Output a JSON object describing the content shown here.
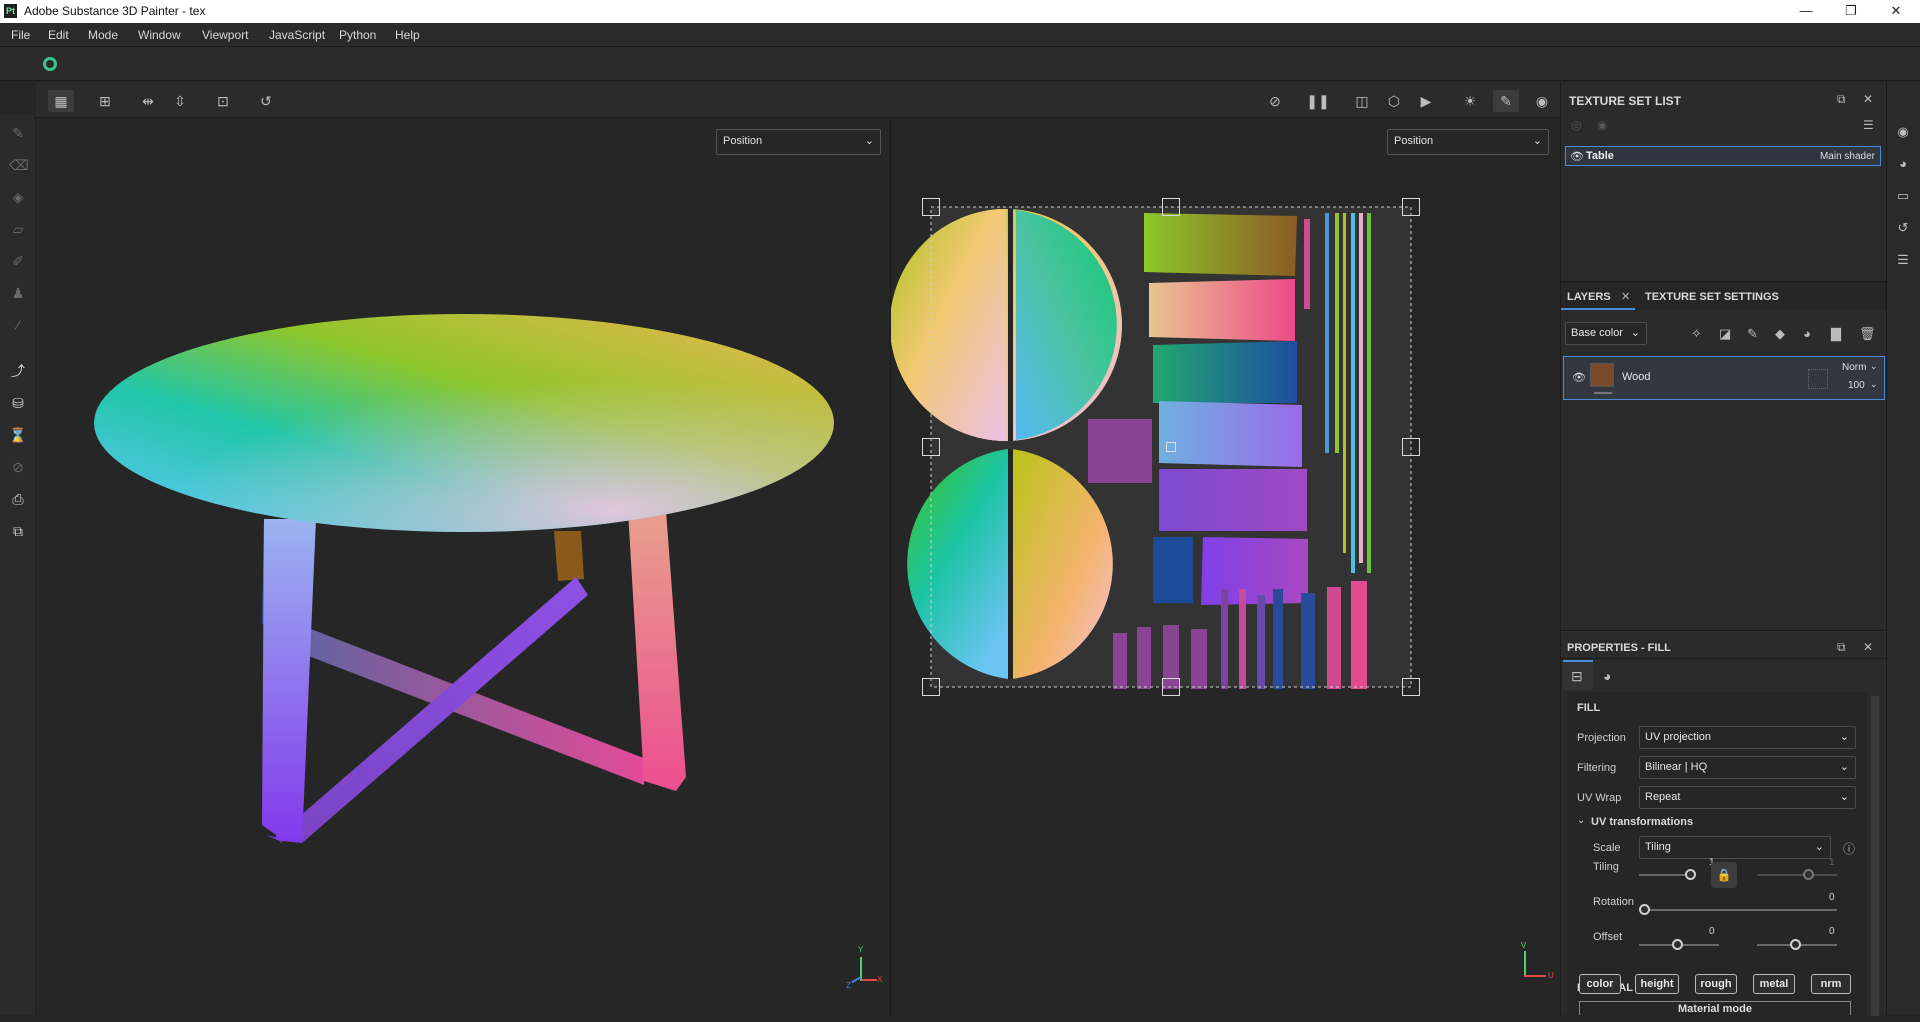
{
  "window": {
    "title": "Adobe Substance 3D Painter - tex",
    "logo": "Pt",
    "minimize": "—",
    "maximize": "❐",
    "close": "✕"
  },
  "menu": [
    "File",
    "Edit",
    "Mode",
    "Window",
    "Viewport",
    "JavaScript",
    "Python",
    "Help"
  ],
  "viewport3d": {
    "channel_dropdown": "Position",
    "axis_y": "Y",
    "axis_x": "X",
    "axis_z": "Z"
  },
  "viewport2d": {
    "channel_dropdown": "Position",
    "axis_v": "V",
    "axis_u": "U"
  },
  "texture_set_list": {
    "title": "TEXTURE SET LIST",
    "item_name": "Table",
    "item_shader": "Main shader"
  },
  "layers": {
    "tab_layers": "LAYERS",
    "tab_settings": "TEXTURE SET SETTINGS",
    "channel": "Base color",
    "layer_name": "Wood",
    "blend_mode": "Norm",
    "opacity": "100"
  },
  "properties": {
    "title": "PROPERTIES - FILL",
    "section_fill": "FILL",
    "projection_label": "Projection",
    "projection_value": "UV projection",
    "filtering_label": "Filtering",
    "filtering_value": "Bilinear | HQ",
    "uvwrap_label": "UV Wrap",
    "uvwrap_value": "Repeat",
    "uv_transformations": "UV transformations",
    "scale_label": "Scale",
    "scale_value": "Tiling",
    "tiling_label": "Tiling",
    "tiling_u": "1",
    "tiling_v": "1",
    "rotation_label": "Rotation",
    "rotation_value": "0",
    "offset_label": "Offset",
    "offset_u": "0",
    "offset_v": "0",
    "section_material": "MATERIAL",
    "material_buttons": [
      "color",
      "height",
      "rough",
      "metal",
      "nrm"
    ],
    "material_mode": "Material mode"
  },
  "colors": {
    "accent": "#3cc48d",
    "selection": "#4a8ad8",
    "panel": "#2e2e2e",
    "viewport": "#262626"
  }
}
